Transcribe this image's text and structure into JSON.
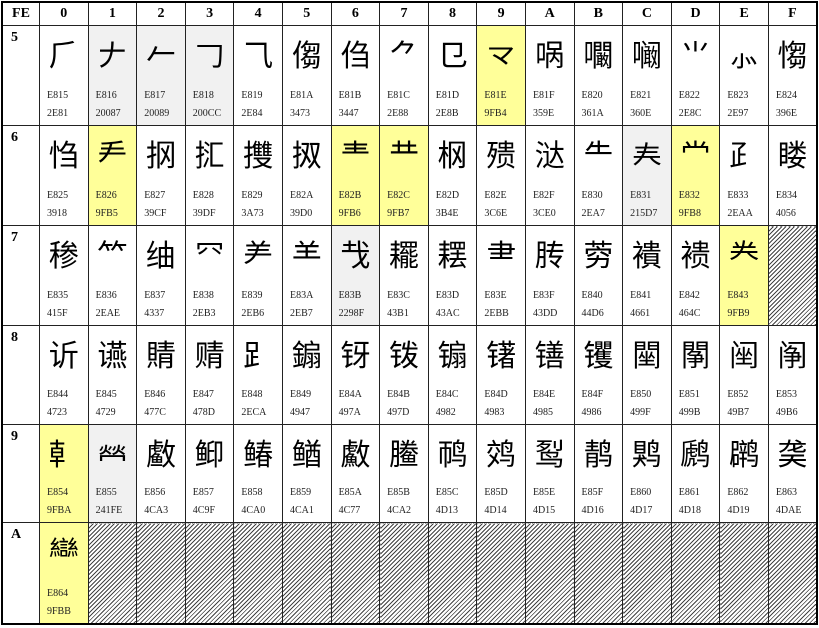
{
  "table": {
    "corner": "FE",
    "columns": [
      "0",
      "1",
      "2",
      "3",
      "4",
      "5",
      "6",
      "7",
      "8",
      "9",
      "A",
      "B",
      "C",
      "D",
      "E",
      "F"
    ],
    "colors": {
      "yellow": "#ffff99",
      "gray": "#f1f1f1"
    },
    "rows": [
      {
        "label": "5",
        "cells": [
          {
            "ch": "⺁",
            "gb": "E815",
            "uni": "2E81"
          },
          {
            "ch": "𠂇",
            "gb": "E816",
            "uni": "20087",
            "hl": "gray"
          },
          {
            "ch": "𠂉",
            "gb": "E817",
            "uni": "20089",
            "hl": "gray"
          },
          {
            "ch": "𠃌",
            "gb": "E818",
            "uni": "200CC",
            "hl": "gray"
          },
          {
            "ch": "⺄",
            "gb": "E819",
            "uni": "2E84"
          },
          {
            "ch": "㑳",
            "gb": "E81A",
            "uni": "3473"
          },
          {
            "ch": "㑇",
            "gb": "E81B",
            "uni": "3447"
          },
          {
            "ch": "⺈",
            "gb": "E81C",
            "uni": "2E88"
          },
          {
            "ch": "⺋",
            "gb": "E81D",
            "uni": "2E8B"
          },
          {
            "ch": "龴",
            "gb": "E81E",
            "uni": "9FB4",
            "hl": "yellow"
          },
          {
            "ch": "㖞",
            "gb": "E81F",
            "uni": "359E"
          },
          {
            "ch": "㘚",
            "gb": "E820",
            "uni": "361A"
          },
          {
            "ch": "㘎",
            "gb": "E821",
            "uni": "360E"
          },
          {
            "ch": "⺌",
            "gb": "E822",
            "uni": "2E8C"
          },
          {
            "ch": "⺗",
            "gb": "E823",
            "uni": "2E97"
          },
          {
            "ch": "㥮",
            "gb": "E824",
            "uni": "396E"
          }
        ]
      },
      {
        "label": "6",
        "cells": [
          {
            "ch": "㤘",
            "gb": "E825",
            "uni": "3918"
          },
          {
            "ch": "龵",
            "gb": "E826",
            "uni": "9FB5",
            "hl": "yellow"
          },
          {
            "ch": "㧏",
            "gb": "E827",
            "uni": "39CF"
          },
          {
            "ch": "㧟",
            "gb": "E828",
            "uni": "39DF"
          },
          {
            "ch": "㩳",
            "gb": "E829",
            "uni": "3A73"
          },
          {
            "ch": "㧐",
            "gb": "E82A",
            "uni": "39D0"
          },
          {
            "ch": "龶",
            "gb": "E82B",
            "uni": "9FB6",
            "hl": "yellow"
          },
          {
            "ch": "龷",
            "gb": "E82C",
            "uni": "9FB7",
            "hl": "yellow"
          },
          {
            "ch": "㭎",
            "gb": "E82D",
            "uni": "3B4E"
          },
          {
            "ch": "㱮",
            "gb": "E82E",
            "uni": "3C6E"
          },
          {
            "ch": "㳠",
            "gb": "E82F",
            "uni": "3CE0"
          },
          {
            "ch": "⺧",
            "gb": "E830",
            "uni": "2EA7"
          },
          {
            "ch": "𡗗",
            "gb": "E831",
            "uni": "215D7",
            "hl": "gray"
          },
          {
            "ch": "龸",
            "gb": "E832",
            "uni": "9FB8",
            "hl": "yellow"
          },
          {
            "ch": "⺪",
            "gb": "E833",
            "uni": "2EAA"
          },
          {
            "ch": "䁖",
            "gb": "E834",
            "uni": "4056"
          }
        ]
      },
      {
        "label": "7",
        "cells": [
          {
            "ch": "䅟",
            "gb": "E835",
            "uni": "415F"
          },
          {
            "ch": "⺮",
            "gb": "E836",
            "uni": "2EAE"
          },
          {
            "ch": "䌷",
            "gb": "E837",
            "uni": "4337"
          },
          {
            "ch": "⺳",
            "gb": "E838",
            "uni": "2EB3"
          },
          {
            "ch": "⺶",
            "gb": "E839",
            "uni": "2EB6"
          },
          {
            "ch": "⺷",
            "gb": "E83A",
            "uni": "2EB7"
          },
          {
            "ch": "𢦏",
            "gb": "E83B",
            "uni": "2298F",
            "hl": "gray"
          },
          {
            "ch": "䎱",
            "gb": "E83C",
            "uni": "43B1"
          },
          {
            "ch": "䎬",
            "gb": "E83D",
            "uni": "43AC"
          },
          {
            "ch": "⺻",
            "gb": "E83E",
            "uni": "2EBB"
          },
          {
            "ch": "䏝",
            "gb": "E83F",
            "uni": "43DD"
          },
          {
            "ch": "䓖",
            "gb": "E840",
            "uni": "44D6"
          },
          {
            "ch": "䙡",
            "gb": "E841",
            "uni": "4661"
          },
          {
            "ch": "䙌",
            "gb": "E842",
            "uni": "464C"
          },
          {
            "ch": "龹",
            "gb": "E843",
            "uni": "9FB9",
            "hl": "yellow"
          },
          {
            "empty": true
          }
        ]
      },
      {
        "label": "8",
        "cells": [
          {
            "ch": "䜣",
            "gb": "E844",
            "uni": "4723"
          },
          {
            "ch": "䜩",
            "gb": "E845",
            "uni": "4729"
          },
          {
            "ch": "䝼",
            "gb": "E846",
            "uni": "477C"
          },
          {
            "ch": "䞍",
            "gb": "E847",
            "uni": "478D"
          },
          {
            "ch": "⻊",
            "gb": "E848",
            "uni": "2ECA"
          },
          {
            "ch": "䥇",
            "gb": "E849",
            "uni": "4947"
          },
          {
            "ch": "䥺",
            "gb": "E84A",
            "uni": "497A"
          },
          {
            "ch": "䥽",
            "gb": "E84B",
            "uni": "497D"
          },
          {
            "ch": "䦂",
            "gb": "E84C",
            "uni": "4982"
          },
          {
            "ch": "䦃",
            "gb": "E84D",
            "uni": "4983"
          },
          {
            "ch": "䦅",
            "gb": "E84E",
            "uni": "4985"
          },
          {
            "ch": "䦆",
            "gb": "E84F",
            "uni": "4986"
          },
          {
            "ch": "䦟",
            "gb": "E850",
            "uni": "499F"
          },
          {
            "ch": "䦛",
            "gb": "E851",
            "uni": "499B"
          },
          {
            "ch": "䦷",
            "gb": "E852",
            "uni": "49B7"
          },
          {
            "ch": "䦶",
            "gb": "E853",
            "uni": "49B6"
          }
        ]
      },
      {
        "label": "9",
        "cells": [
          {
            "ch": "龺",
            "gb": "E854",
            "uni": "9FBA",
            "hl": "yellow"
          },
          {
            "ch": "𤇾",
            "gb": "E855",
            "uni": "241FE",
            "hl": "gray"
          },
          {
            "ch": "䲣",
            "gb": "E856",
            "uni": "4CA3"
          },
          {
            "ch": "䲟",
            "gb": "E857",
            "uni": "4C9F"
          },
          {
            "ch": "䲠",
            "gb": "E858",
            "uni": "4CA0"
          },
          {
            "ch": "䲡",
            "gb": "E859",
            "uni": "4CA1"
          },
          {
            "ch": "䱷",
            "gb": "E85A",
            "uni": "4C77"
          },
          {
            "ch": "䲢",
            "gb": "E85B",
            "uni": "4CA2"
          },
          {
            "ch": "䴓",
            "gb": "E85C",
            "uni": "4D13"
          },
          {
            "ch": "䴔",
            "gb": "E85D",
            "uni": "4D14"
          },
          {
            "ch": "䴕",
            "gb": "E85E",
            "uni": "4D15"
          },
          {
            "ch": "䴖",
            "gb": "E85F",
            "uni": "4D16"
          },
          {
            "ch": "䴗",
            "gb": "E860",
            "uni": "4D17"
          },
          {
            "ch": "䴘",
            "gb": "E861",
            "uni": "4D18"
          },
          {
            "ch": "䴙",
            "gb": "E862",
            "uni": "4D19"
          },
          {
            "ch": "䶮",
            "gb": "E863",
            "uni": "4DAE"
          }
        ]
      },
      {
        "label": "A",
        "cells": [
          {
            "ch": "龻",
            "gb": "E864",
            "uni": "9FBB",
            "hl": "yellow"
          },
          {
            "empty": true
          },
          {
            "empty": true
          },
          {
            "empty": true
          },
          {
            "empty": true
          },
          {
            "empty": true
          },
          {
            "empty": true
          },
          {
            "empty": true
          },
          {
            "empty": true
          },
          {
            "empty": true
          },
          {
            "empty": true
          },
          {
            "empty": true
          },
          {
            "empty": true
          },
          {
            "empty": true
          },
          {
            "empty": true
          },
          {
            "empty": true
          }
        ]
      }
    ]
  }
}
